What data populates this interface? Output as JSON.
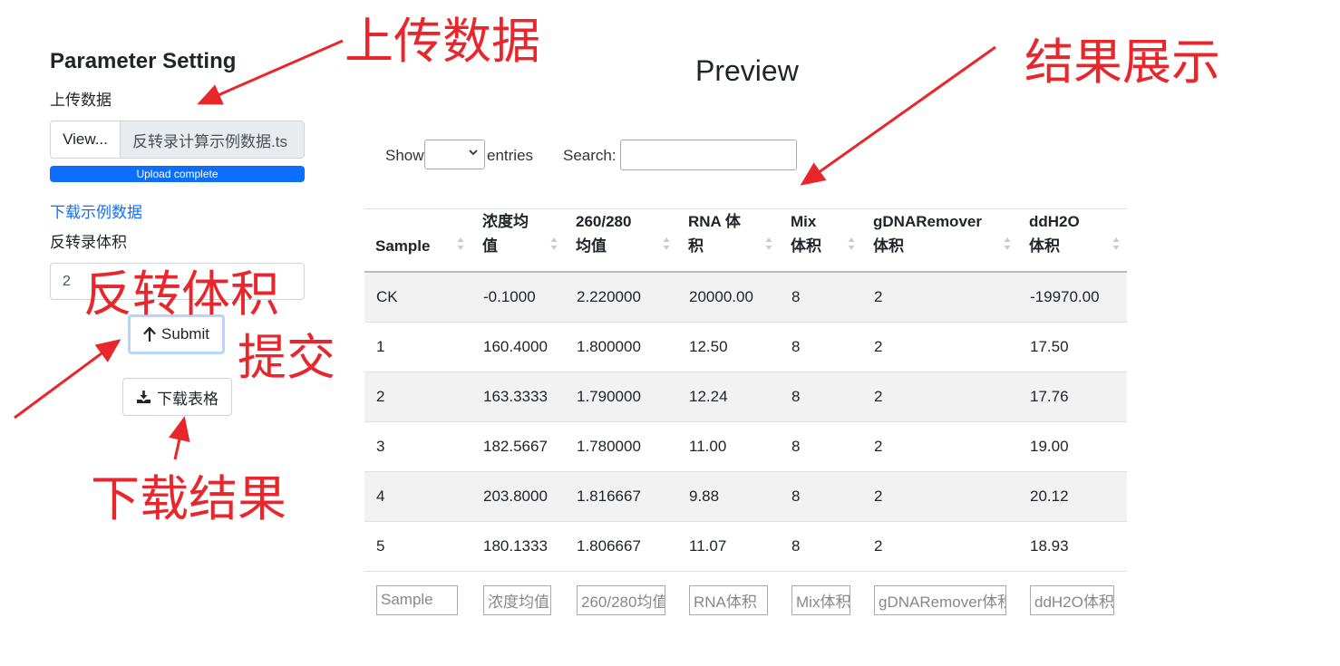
{
  "sidebar": {
    "title": "Parameter Setting",
    "upload_label": "上传数据",
    "file_button": "View...",
    "file_name": "反转录计算示例数据.ts",
    "progress_text": "Upload complete",
    "progress_value": 1.0,
    "example_link": "下载示例数据",
    "volume_label": "反转录体积",
    "volume_value": "2",
    "submit_label": "Submit",
    "download_label": "下载表格",
    "icons": {
      "submit": "arrow-up-icon",
      "download": "download-icon"
    }
  },
  "main": {
    "title": "Preview",
    "show_label": "Show",
    "entries_label": "entries",
    "search_label": "Search:",
    "search_value": ""
  },
  "table": {
    "headers": [
      [
        "Sample"
      ],
      [
        "浓度均",
        "值"
      ],
      [
        "260/280",
        "均值"
      ],
      [
        "RNA 体",
        "积"
      ],
      [
        "Mix",
        "体积"
      ],
      [
        "gDNARemover",
        "体积"
      ],
      [
        "ddH2O",
        "体积"
      ]
    ],
    "rows": [
      [
        "CK",
        "-0.1000",
        "2.220000",
        "20000.00",
        "8",
        "2",
        "-19970.00"
      ],
      [
        "1",
        "160.4000",
        "1.800000",
        "12.50",
        "8",
        "2",
        "17.50"
      ],
      [
        "2",
        "163.3333",
        "1.790000",
        "12.24",
        "8",
        "2",
        "17.76"
      ],
      [
        "3",
        "182.5667",
        "1.780000",
        "11.00",
        "8",
        "2",
        "19.00"
      ],
      [
        "4",
        "203.8000",
        "1.816667",
        "9.88",
        "8",
        "2",
        "20.12"
      ],
      [
        "5",
        "180.1333",
        "1.806667",
        "11.07",
        "8",
        "2",
        "18.93"
      ]
    ],
    "filters": [
      "Sample",
      "浓度均值",
      "260/280均值",
      "RNA体积",
      "Mix体积",
      "gDNARemover体积",
      "ddH2O体积"
    ]
  },
  "annotations": {
    "upload": "上传数据",
    "results": "结果展示",
    "volume": "反转体积",
    "submit": "提交",
    "download": "下载结果"
  },
  "colors": {
    "accent": "#0d6efd",
    "annotation": "#e8262b",
    "stripe": "#f2f2f2"
  }
}
